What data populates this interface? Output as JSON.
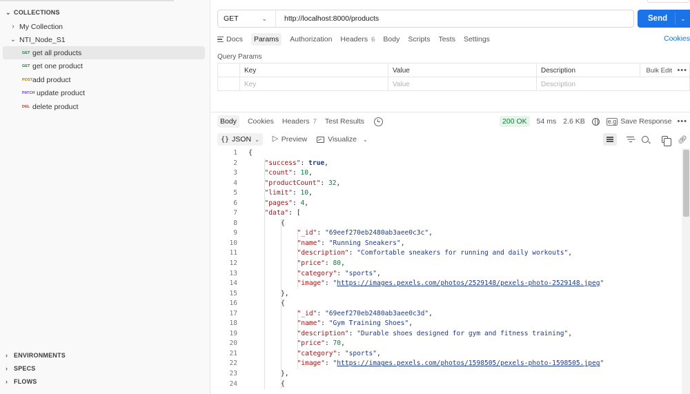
{
  "sidebar": {
    "collections_header": "COLLECTIONS",
    "collections": [
      {
        "label": "My Collection"
      },
      {
        "label": "NTI_Node_S1"
      }
    ],
    "requests": [
      {
        "method": "GET",
        "label": "get all products",
        "selected": true
      },
      {
        "method": "GET",
        "label": "get one product"
      },
      {
        "method": "POST",
        "label": "add product"
      },
      {
        "method": "PATCH",
        "label": "update product"
      },
      {
        "method": "DEL",
        "label": "delete product"
      }
    ],
    "bottom_sections": [
      {
        "label": "ENVIRONMENTS"
      },
      {
        "label": "SPECS"
      },
      {
        "label": "FLOWS"
      }
    ]
  },
  "request": {
    "method": "GET",
    "url": "http://localhost:8000/products",
    "send_label": "Send",
    "tabs": [
      {
        "label": "Docs"
      },
      {
        "label": "Params",
        "active": true
      },
      {
        "label": "Authorization"
      },
      {
        "label": "Headers",
        "count": "6"
      },
      {
        "label": "Body"
      },
      {
        "label": "Scripts"
      },
      {
        "label": "Tests"
      },
      {
        "label": "Settings"
      }
    ],
    "cookies_link": "Cookies",
    "query_params_title": "Query Params",
    "params_headers": {
      "key": "Key",
      "value": "Value",
      "description": "Description",
      "bulk_edit": "Bulk Edit"
    },
    "params_placeholders": {
      "key": "Key",
      "value": "Value",
      "description": "Description"
    }
  },
  "response": {
    "tabs": [
      {
        "label": "Body",
        "active": true
      },
      {
        "label": "Cookies"
      },
      {
        "label": "Headers",
        "count": "7"
      },
      {
        "label": "Test Results"
      }
    ],
    "status": "200 OK",
    "time": "54 ms",
    "size": "2.6 KB",
    "save_response": "Save Response",
    "format": "JSON",
    "preview": "Preview",
    "visualize": "Visualize",
    "colors": {
      "status_bg": "#e6f4ea",
      "status_fg": "#0f7b3a",
      "accent": "#1a73e8"
    },
    "code_lines": [
      {
        "n": "1",
        "indent": 0,
        "tokens": [
          [
            "p",
            "{"
          ]
        ]
      },
      {
        "n": "2",
        "indent": 1,
        "tokens": [
          [
            "k",
            "\"success\""
          ],
          [
            "p",
            ": "
          ],
          [
            "b",
            "true"
          ],
          [
            "p",
            ","
          ]
        ]
      },
      {
        "n": "3",
        "indent": 1,
        "tokens": [
          [
            "k",
            "\"count\""
          ],
          [
            "p",
            ": "
          ],
          [
            "n",
            "10"
          ],
          [
            "p",
            ","
          ]
        ]
      },
      {
        "n": "4",
        "indent": 1,
        "tokens": [
          [
            "k",
            "\"productCount\""
          ],
          [
            "p",
            ": "
          ],
          [
            "n",
            "32"
          ],
          [
            "p",
            ","
          ]
        ]
      },
      {
        "n": "5",
        "indent": 1,
        "tokens": [
          [
            "k",
            "\"limit\""
          ],
          [
            "p",
            ": "
          ],
          [
            "n",
            "10"
          ],
          [
            "p",
            ","
          ]
        ]
      },
      {
        "n": "6",
        "indent": 1,
        "tokens": [
          [
            "k",
            "\"pages\""
          ],
          [
            "p",
            ": "
          ],
          [
            "n",
            "4"
          ],
          [
            "p",
            ","
          ]
        ]
      },
      {
        "n": "7",
        "indent": 1,
        "tokens": [
          [
            "k",
            "\"data\""
          ],
          [
            "p",
            ": ["
          ]
        ]
      },
      {
        "n": "8",
        "indent": 2,
        "tokens": [
          [
            "p",
            "{"
          ]
        ]
      },
      {
        "n": "9",
        "indent": 3,
        "tokens": [
          [
            "k",
            "\"_id\""
          ],
          [
            "p",
            ": "
          ],
          [
            "s",
            "\"69eef270eb2480ab3aee0c3c\""
          ],
          [
            "p",
            ","
          ]
        ]
      },
      {
        "n": "10",
        "indent": 3,
        "tokens": [
          [
            "k",
            "\"name\""
          ],
          [
            "p",
            ": "
          ],
          [
            "s",
            "\"Running Sneakers\""
          ],
          [
            "p",
            ","
          ]
        ]
      },
      {
        "n": "11",
        "indent": 3,
        "tokens": [
          [
            "k",
            "\"description\""
          ],
          [
            "p",
            ": "
          ],
          [
            "s",
            "\"Comfortable sneakers for running and daily workouts\""
          ],
          [
            "p",
            ","
          ]
        ]
      },
      {
        "n": "12",
        "indent": 3,
        "tokens": [
          [
            "k",
            "\"price\""
          ],
          [
            "p",
            ": "
          ],
          [
            "n",
            "80"
          ],
          [
            "p",
            ","
          ]
        ]
      },
      {
        "n": "13",
        "indent": 3,
        "tokens": [
          [
            "k",
            "\"category\""
          ],
          [
            "p",
            ": "
          ],
          [
            "s",
            "\"sports\""
          ],
          [
            "p",
            ","
          ]
        ]
      },
      {
        "n": "14",
        "indent": 3,
        "tokens": [
          [
            "k",
            "\"image\""
          ],
          [
            "p",
            ": "
          ],
          [
            "s",
            "\""
          ],
          [
            "u",
            "https://images.pexels.com/photos/2529148/pexels-photo-2529148.jpeg"
          ],
          [
            "s",
            "\""
          ]
        ]
      },
      {
        "n": "15",
        "indent": 2,
        "tokens": [
          [
            "p",
            "},"
          ]
        ]
      },
      {
        "n": "16",
        "indent": 2,
        "tokens": [
          [
            "p",
            "{"
          ]
        ]
      },
      {
        "n": "17",
        "indent": 3,
        "tokens": [
          [
            "k",
            "\"_id\""
          ],
          [
            "p",
            ": "
          ],
          [
            "s",
            "\"69eef270eb2480ab3aee0c3d\""
          ],
          [
            "p",
            ","
          ]
        ]
      },
      {
        "n": "18",
        "indent": 3,
        "tokens": [
          [
            "k",
            "\"name\""
          ],
          [
            "p",
            ": "
          ],
          [
            "s",
            "\"Gym Training Shoes\""
          ],
          [
            "p",
            ","
          ]
        ]
      },
      {
        "n": "19",
        "indent": 3,
        "tokens": [
          [
            "k",
            "\"description\""
          ],
          [
            "p",
            ": "
          ],
          [
            "s",
            "\"Durable shoes designed for gym and fitness training\""
          ],
          [
            "p",
            ","
          ]
        ]
      },
      {
        "n": "20",
        "indent": 3,
        "tokens": [
          [
            "k",
            "\"price\""
          ],
          [
            "p",
            ": "
          ],
          [
            "n",
            "70"
          ],
          [
            "p",
            ","
          ]
        ]
      },
      {
        "n": "21",
        "indent": 3,
        "tokens": [
          [
            "k",
            "\"category\""
          ],
          [
            "p",
            ": "
          ],
          [
            "s",
            "\"sports\""
          ],
          [
            "p",
            ","
          ]
        ]
      },
      {
        "n": "22",
        "indent": 3,
        "tokens": [
          [
            "k",
            "\"image\""
          ],
          [
            "p",
            ": "
          ],
          [
            "s",
            "\""
          ],
          [
            "u",
            "https://images.pexels.com/photos/1598505/pexels-photo-1598505.jpeg"
          ],
          [
            "s",
            "\""
          ]
        ]
      },
      {
        "n": "23",
        "indent": 2,
        "tokens": [
          [
            "p",
            "},"
          ]
        ]
      },
      {
        "n": "24",
        "indent": 2,
        "tokens": [
          [
            "p",
            "{"
          ]
        ]
      }
    ]
  }
}
